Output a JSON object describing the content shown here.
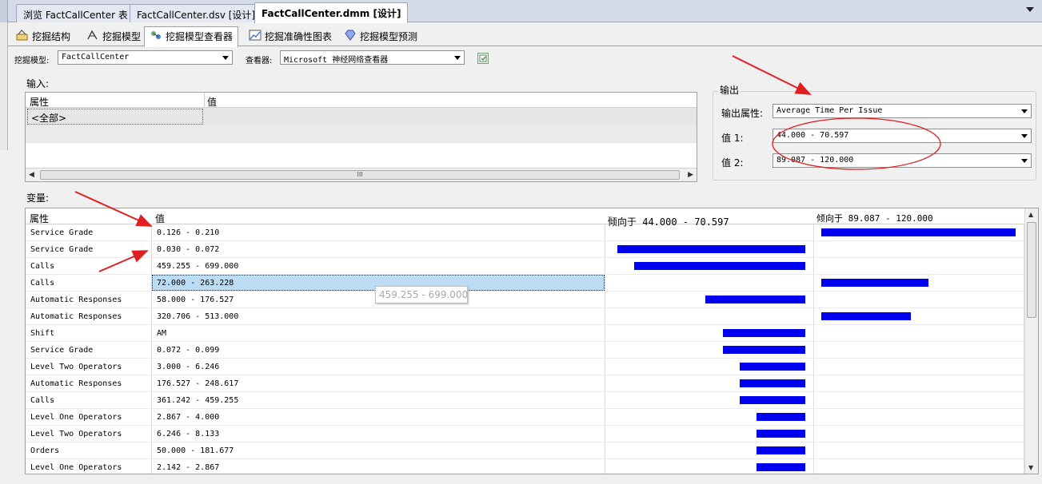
{
  "doc_tabs": [
    {
      "label": "浏览 FactCallCenter 表"
    },
    {
      "label": "FactCallCenter.dsv [设计]"
    },
    {
      "label": "FactCallCenter.dmm [设计]"
    }
  ],
  "designer_tabs": [
    {
      "label": "挖掘结构",
      "icon": "mining-structure-icon"
    },
    {
      "label": "挖掘模型",
      "icon": "mining-model-icon"
    },
    {
      "label": "挖掘模型查看器",
      "icon": "model-viewer-icon"
    },
    {
      "label": "挖掘准确性图表",
      "icon": "accuracy-chart-icon"
    },
    {
      "label": "挖掘模型预测",
      "icon": "prediction-icon"
    }
  ],
  "toolbar": {
    "model_label": "挖掘模型:",
    "model_value": "FactCallCenter",
    "viewer_label": "查看器:",
    "viewer_value": "Microsoft 神经网络查看器"
  },
  "input": {
    "title": "输入:",
    "col_attr": "属性",
    "col_val": "值",
    "all_cell": "<全部>",
    "scroll_grip": "III"
  },
  "output": {
    "title": "输出",
    "attr_label": "输出属性:",
    "attr_value": "Average Time Per Issue",
    "v1_label": "值 1:",
    "v1_value": "44.000 - 70.597",
    "v2_label": "值 2:",
    "v2_value": "89.087 - 120.000"
  },
  "variables": {
    "title": "变量:",
    "col_attr": "属性",
    "col_val": "值",
    "col_v1": "倾向于 44.000 - 70.597",
    "col_v2": "倾向于 89.087 - 120.000",
    "rows": [
      {
        "attr": "Service Grade",
        "val": "0.126 - 0.210",
        "v1": 0,
        "v2": 100
      },
      {
        "attr": "Service Grade",
        "val": "0.030 - 0.072",
        "v1": 100,
        "v2": 0
      },
      {
        "attr": "Calls",
        "val": "459.255 - 699.000",
        "v1": 91,
        "v2": 0
      },
      {
        "attr": "Calls",
        "val": "72.000 - 263.228",
        "v1": 0,
        "v2": 55
      },
      {
        "attr": "Automatic Responses",
        "val": "58.000 - 176.527",
        "v1": 53,
        "v2": 0
      },
      {
        "attr": "Automatic Responses",
        "val": "320.706 - 513.000",
        "v1": 0,
        "v2": 46
      },
      {
        "attr": "Shift",
        "val": "AM",
        "v1": 44,
        "v2": 0
      },
      {
        "attr": "Service Grade",
        "val": "0.072 - 0.099",
        "v1": 44,
        "v2": 0
      },
      {
        "attr": "Level Two Operators",
        "val": "3.000 - 6.246",
        "v1": 35,
        "v2": 0
      },
      {
        "attr": "Automatic Responses",
        "val": "176.527 - 248.617",
        "v1": 35,
        "v2": 0
      },
      {
        "attr": "Calls",
        "val": "361.242 - 459.255",
        "v1": 35,
        "v2": 0
      },
      {
        "attr": "Level One Operators",
        "val": "2.867 - 4.000",
        "v1": 26,
        "v2": 0
      },
      {
        "attr": "Level Two Operators",
        "val": "6.246 - 8.133",
        "v1": 26,
        "v2": 0
      },
      {
        "attr": "Orders",
        "val": "50.000 - 181.677",
        "v1": 26,
        "v2": 0
      },
      {
        "attr": "Level One Operators",
        "val": "2.142 - 2.867",
        "v1": 26,
        "v2": 0
      }
    ],
    "selected_row": 3,
    "bar_color": "#0000f0"
  },
  "tooltip": "459.255 - 699.000",
  "annotation_color": "#e02020"
}
